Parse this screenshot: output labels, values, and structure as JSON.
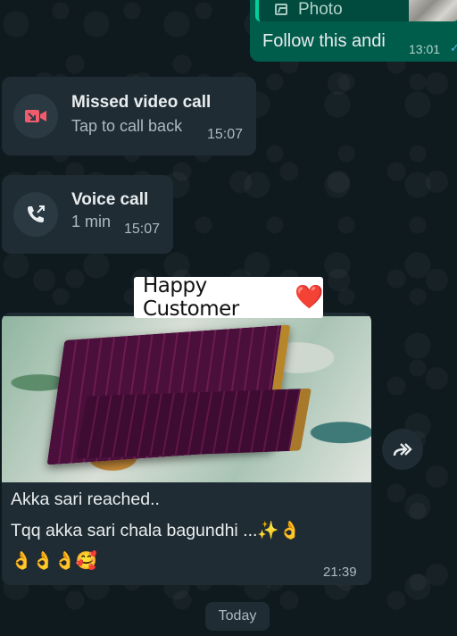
{
  "outgoing_reply": {
    "quoted_label": "Photo",
    "text": "Follow this andi",
    "time": "13:01",
    "ticks": "✓✓"
  },
  "calls": [
    {
      "title": "Missed video call",
      "subtitle": "Tap to call back",
      "time": "15:07",
      "icon": "missed-video-call-icon"
    },
    {
      "title": "Voice call",
      "subtitle": "1 min",
      "time": "15:07",
      "icon": "outgoing-call-icon"
    }
  ],
  "image_message": {
    "tag_text": "Happy Customer",
    "tag_emoji": "❤️",
    "line1": "Akka sari reached..",
    "line2": "Tqq akka sari chala bagundhi ...✨👌",
    "line3": "👌👌👌🥰",
    "time": "21:39"
  },
  "forward_icon": "forward-icon",
  "date_divider": "Today",
  "colors": {
    "outgoing_bubble": "#005c4b",
    "incoming_bubble": "#1f2c33",
    "missed_call": "#f15c6d",
    "read_ticks": "#53bdeb"
  }
}
